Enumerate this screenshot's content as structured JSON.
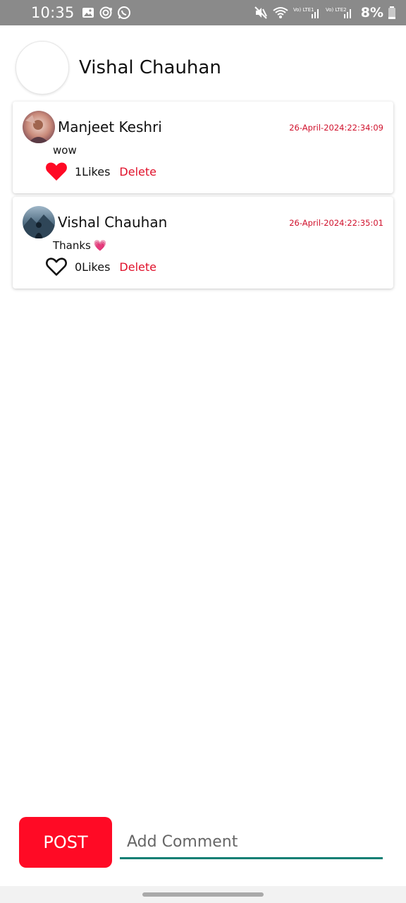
{
  "status_bar": {
    "time": "10:35",
    "left_icons": [
      "gallery-icon",
      "sync-icon",
      "whatsapp-icon"
    ],
    "right_icons": [
      "mute-icon",
      "wifi-icon",
      "volte-lte1-signal-icon",
      "volte-lte2-signal-icon",
      "battery-icon"
    ],
    "sim1_label": "Vo) LTE1",
    "sim2_label": "Vo) LTE2",
    "battery": "8%"
  },
  "header": {
    "name": "Vishal Chauhan"
  },
  "comments": [
    {
      "author": "Manjeet Keshri",
      "timestamp": "26-April-2024:22:34:09",
      "text": "wow",
      "emoji": "",
      "liked": true,
      "likes": "1Likes",
      "delete_label": "Delete"
    },
    {
      "author": "Vishal Chauhan",
      "timestamp": "26-April-2024:22:35:01",
      "text": "Thanks",
      "emoji": "💗",
      "liked": false,
      "likes": "0Likes",
      "delete_label": "Delete"
    }
  ],
  "composer": {
    "post_label": "POST",
    "placeholder": "Add Comment",
    "value": ""
  },
  "colors": {
    "accent_red": "#ff0a25",
    "delete_red": "#e0102a",
    "date_red": "#d0122d",
    "input_underline": "#0f7f74",
    "status_bar_bg": "#8a8a8a"
  }
}
